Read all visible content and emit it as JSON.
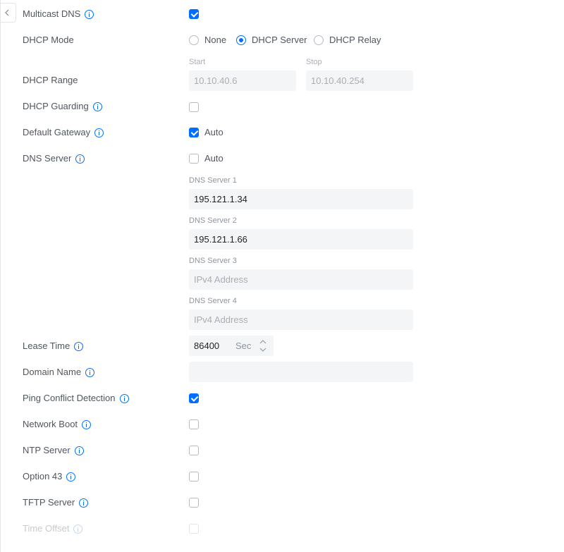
{
  "form": {
    "multicast_dns": {
      "label": "Multicast DNS",
      "checked": true
    },
    "dhcp_mode": {
      "label": "DHCP Mode",
      "options": [
        "None",
        "DHCP Server",
        "DHCP Relay"
      ],
      "selected": "DHCP Server"
    },
    "dhcp_range": {
      "label": "DHCP Range",
      "start_label": "Start",
      "start_value": "10.10.40.6",
      "stop_label": "Stop",
      "stop_value": "10.10.40.254"
    },
    "dhcp_guarding": {
      "label": "DHCP Guarding",
      "checked": false
    },
    "default_gateway": {
      "label": "Default Gateway",
      "checked": true,
      "option_label": "Auto"
    },
    "dns_server": {
      "label": "DNS Server",
      "checked": false,
      "option_label": "Auto",
      "servers": [
        {
          "label": "DNS Server 1",
          "value": "195.121.1.34",
          "placeholder": "IPv4 Address"
        },
        {
          "label": "DNS Server 2",
          "value": "195.121.1.66",
          "placeholder": "IPv4 Address"
        },
        {
          "label": "DNS Server 3",
          "value": "",
          "placeholder": "IPv4 Address"
        },
        {
          "label": "DNS Server 4",
          "value": "",
          "placeholder": "IPv4 Address"
        }
      ]
    },
    "lease_time": {
      "label": "Lease Time",
      "value": "86400",
      "unit": "Sec"
    },
    "domain_name": {
      "label": "Domain Name",
      "value": ""
    },
    "ping_conflict_detection": {
      "label": "Ping Conflict Detection",
      "checked": true
    },
    "network_boot": {
      "label": "Network Boot",
      "checked": false
    },
    "ntp_server": {
      "label": "NTP Server",
      "checked": false
    },
    "option_43": {
      "label": "Option 43",
      "checked": false
    },
    "tftp_server": {
      "label": "TFTP Server",
      "checked": false
    },
    "time_offset": {
      "label": "Time Offset",
      "checked": false,
      "disabled": true
    }
  },
  "colors": {
    "accent": "#006fff",
    "label_text": "#50565e",
    "field_background": "#f4f5f6",
    "disabled_text": "#c7cbd0"
  }
}
